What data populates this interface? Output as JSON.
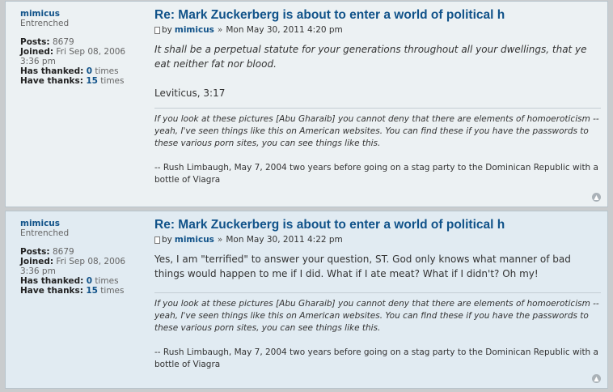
{
  "posts": [
    {
      "username": "mimicus",
      "rank": "Entrenched",
      "posts_label": "Posts:",
      "posts_count": "8679",
      "joined_label": "Joined:",
      "joined_value": "Fri Sep 08, 2006 3:36 pm",
      "thanked_label": "Has thanked:",
      "thanked_count": "0",
      "thanks_label": "Have thanks:",
      "thanks_count": "15",
      "times": "times",
      "title": "Re: Mark Zuckerberg is about to enter a world of political h",
      "by": "by",
      "author": "mimicus",
      "sep": "»",
      "date": "Mon May 30, 2011 4:20 pm",
      "body_line1": "It shall be a perpetual statute for your generations throughout all your dwellings, that ye eat neither fat nor blood.",
      "body_line2": "Leviticus, 3:17",
      "sig_quote": "If you look at these pictures [Abu Gharaib] you cannot deny that there are elements of homoeroticism -- yeah, I've seen things like this on American websites. You can find these if you have the passwords to these various porn sites, you can see things like this.",
      "sig_attr": "-- Rush Limbaugh, May 7, 2004 two years before going on a stag party to the Dominican Republic with a bottle of Viagra"
    },
    {
      "username": "mimicus",
      "rank": "Entrenched",
      "posts_label": "Posts:",
      "posts_count": "8679",
      "joined_label": "Joined:",
      "joined_value": "Fri Sep 08, 2006 3:36 pm",
      "thanked_label": "Has thanked:",
      "thanked_count": "0",
      "thanks_label": "Have thanks:",
      "thanks_count": "15",
      "times": "times",
      "title": "Re: Mark Zuckerberg is about to enter a world of political h",
      "by": "by",
      "author": "mimicus",
      "sep": "»",
      "date": "Mon May 30, 2011 4:22 pm",
      "body_line1": "Yes, I am \"terrified\" to answer your question, ST. God only knows what manner of bad things would happen to me if I did. What if I ate meat? What if I didn't? Oh my!",
      "sig_quote": "If you look at these pictures [Abu Gharaib] you cannot deny that there are elements of homoeroticism -- yeah, I've seen things like this on American websites. You can find these if you have the passwords to these various porn sites, you can see things like this.",
      "sig_attr": "-- Rush Limbaugh, May 7, 2004 two years before going on a stag party to the Dominican Republic with a bottle of Viagra"
    }
  ],
  "icons": {
    "post_icon": "file-icon",
    "top_icon": "back-to-top-icon"
  }
}
